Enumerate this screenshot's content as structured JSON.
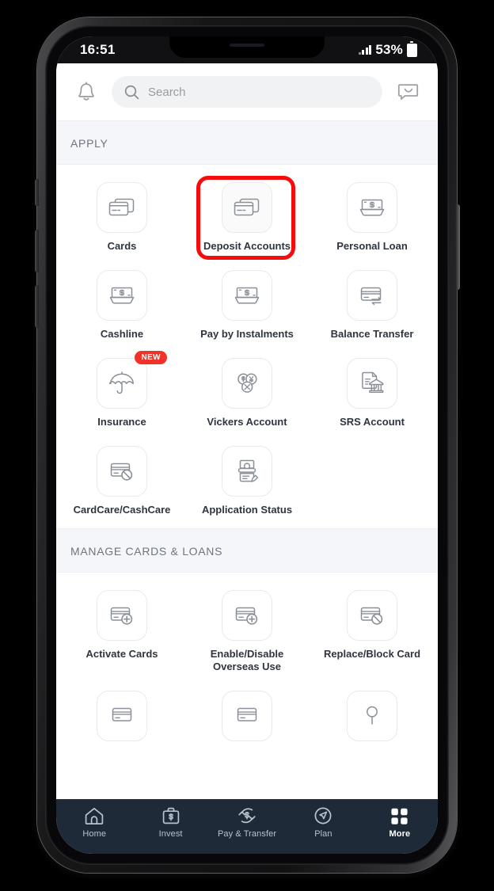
{
  "status_bar": {
    "time": "16:51",
    "battery_percent": "53%",
    "signal_icon": "cellular-signal-icon",
    "battery_icon": "battery-icon"
  },
  "header": {
    "bell_icon": "notification-bell-icon",
    "search_icon": "search-icon",
    "chat_icon": "chat-bubble-icon",
    "search_placeholder": "Search",
    "search_value": ""
  },
  "sections": [
    {
      "title": "APPLY",
      "tiles": [
        {
          "label": "Cards",
          "icon": "credit-cards-stack-icon",
          "badge": ""
        },
        {
          "label": "Deposit Accounts",
          "icon": "credit-cards-stack-icon",
          "badge": "",
          "highlighted": true
        },
        {
          "label": "Personal Loan",
          "icon": "cash-tray-icon",
          "badge": ""
        },
        {
          "label": "Cashline",
          "icon": "cash-tray-icon",
          "badge": ""
        },
        {
          "label": "Pay by Instalments",
          "icon": "cash-tray-icon",
          "badge": ""
        },
        {
          "label": "Balance Transfer",
          "icon": "card-transfer-arrows-icon",
          "badge": ""
        },
        {
          "label": "Insurance",
          "icon": "umbrella-icon",
          "badge": "NEW"
        },
        {
          "label": "Vickers Account",
          "icon": "currency-coins-icon",
          "badge": ""
        },
        {
          "label": "SRS Account",
          "icon": "bank-document-icon",
          "badge": ""
        },
        {
          "label": "CardCare/CashCare",
          "icon": "card-blocked-icon",
          "badge": ""
        },
        {
          "label": "Application Status",
          "icon": "document-person-icon",
          "badge": ""
        }
      ]
    },
    {
      "title": "MANAGE CARDS & LOANS",
      "tiles": [
        {
          "label": "Activate Cards",
          "icon": "card-plus-icon",
          "badge": ""
        },
        {
          "label": "Enable/Disable Overseas Use",
          "icon": "card-plus-icon",
          "badge": ""
        },
        {
          "label": "Replace/Block Card",
          "icon": "card-blocked-icon",
          "badge": ""
        },
        {
          "label": "",
          "icon": "card-icon",
          "badge": ""
        },
        {
          "label": "",
          "icon": "card-icon",
          "badge": ""
        },
        {
          "label": "",
          "icon": "key-icon",
          "badge": ""
        }
      ]
    }
  ],
  "bottom_nav": {
    "items": [
      {
        "label": "Home",
        "icon": "home-icon",
        "active": false
      },
      {
        "label": "Invest",
        "icon": "briefcase-dollar-icon",
        "active": false
      },
      {
        "label": "Pay & Transfer",
        "icon": "transfer-dollar-icon",
        "active": false
      },
      {
        "label": "Plan",
        "icon": "compass-icon",
        "active": false
      },
      {
        "label": "More",
        "icon": "grid-squares-icon",
        "active": true
      }
    ]
  },
  "annotation": {
    "highlight_target": "Deposit Accounts",
    "highlight_color": "#f50d0d"
  },
  "colors": {
    "nav_background": "#1e2a38",
    "section_header_background": "#f5f6f9",
    "badge_red": "#f03228",
    "icon_stroke": "#6e7480"
  }
}
